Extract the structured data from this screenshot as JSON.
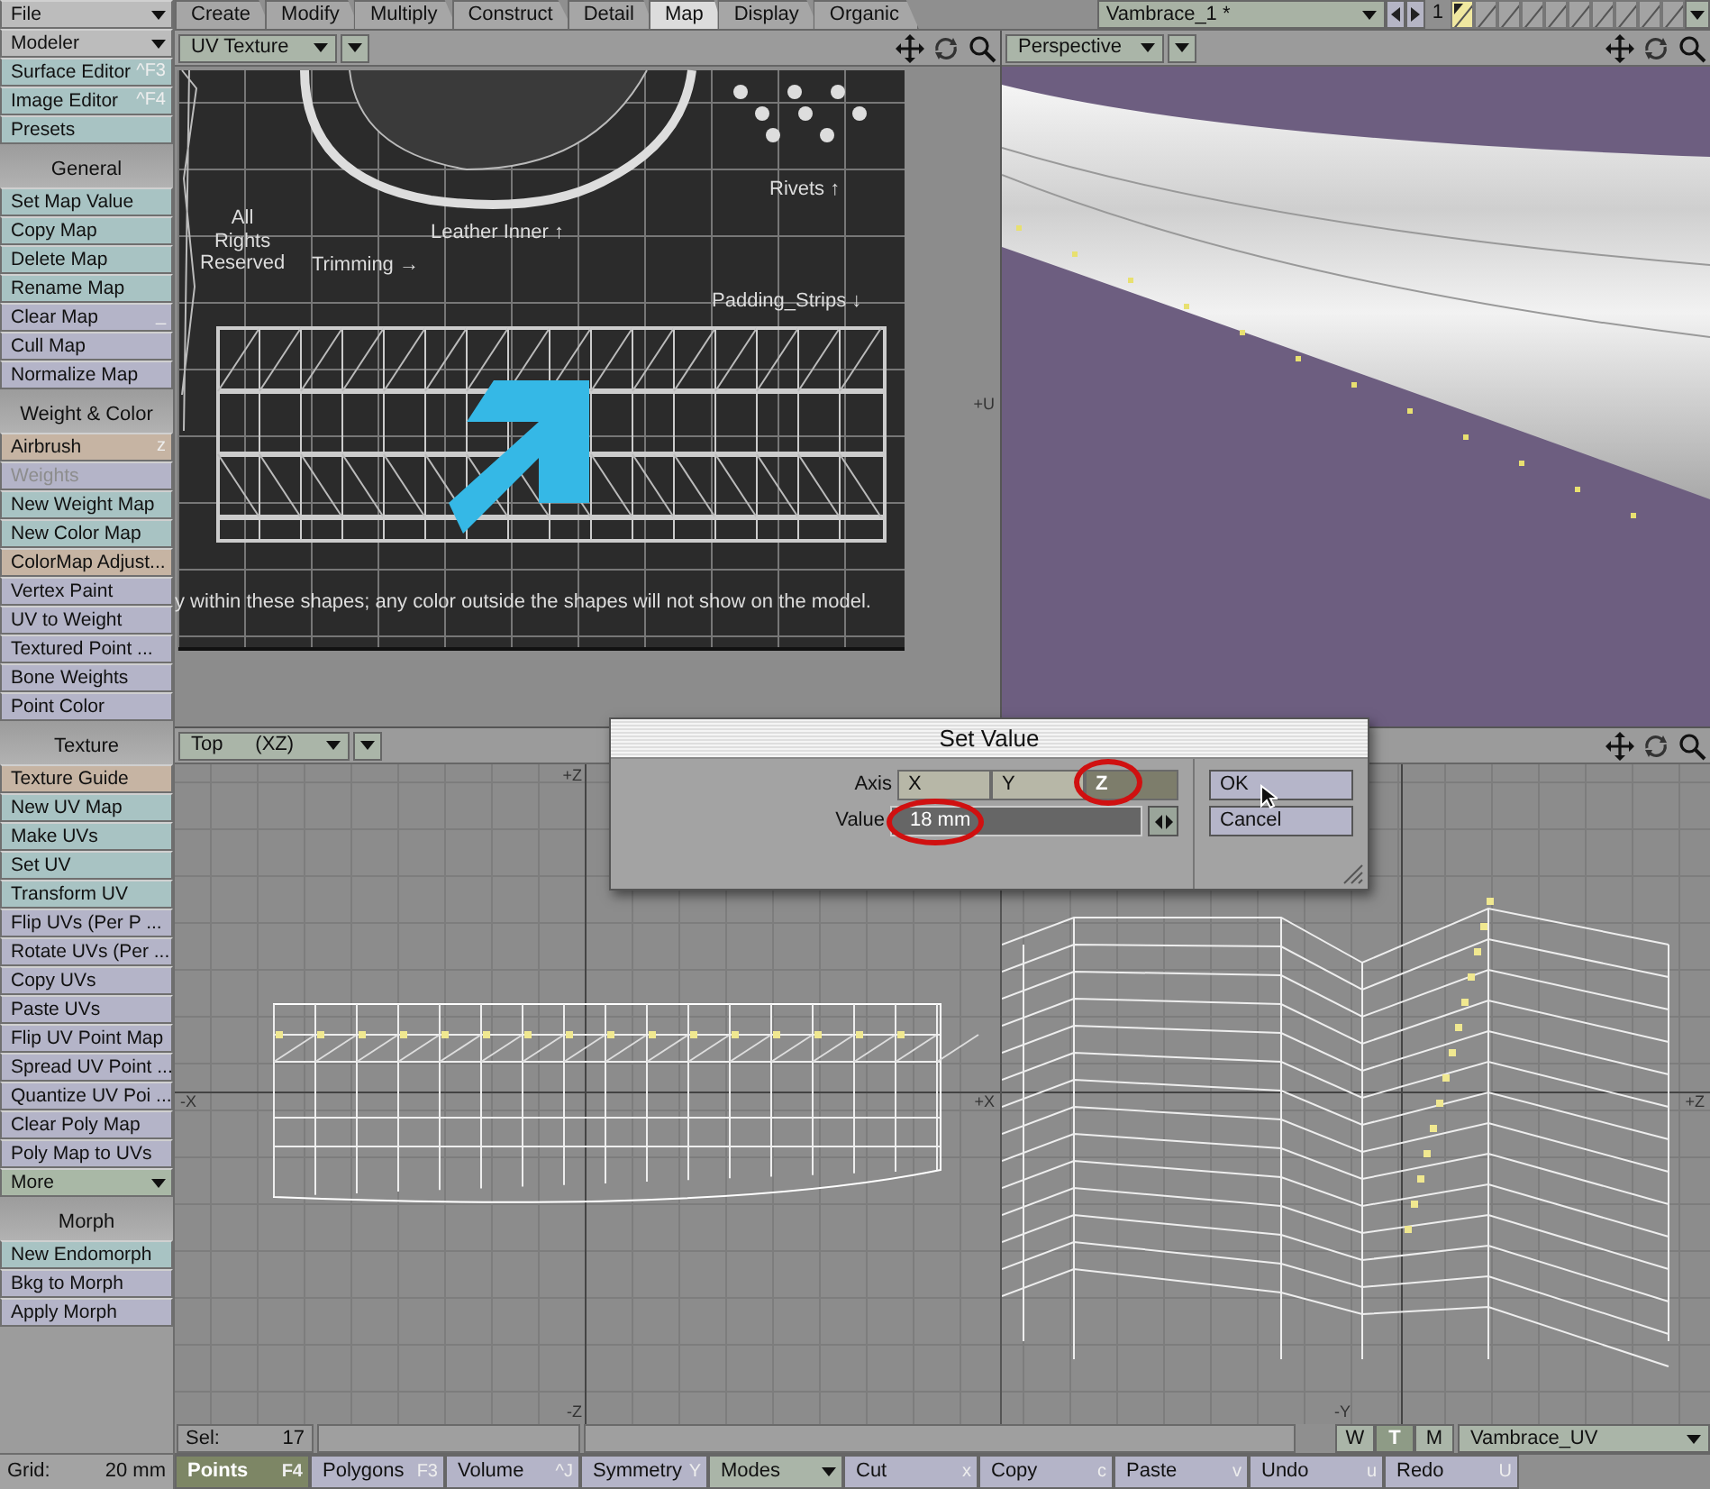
{
  "sidebar": {
    "items": [
      {
        "kind": "dropdown",
        "label": "File"
      },
      {
        "kind": "dropdown",
        "label": "Modeler"
      },
      {
        "kind": "button",
        "label": "Surface Editor",
        "shortcut": "^F3",
        "color": "#a8c3c3"
      },
      {
        "kind": "button",
        "label": "Image Editor",
        "shortcut": "^F4",
        "color": "#a8c3c3"
      },
      {
        "kind": "button",
        "label": "Presets",
        "color": "#a8c3c3"
      },
      {
        "kind": "header",
        "label": "General"
      },
      {
        "kind": "button",
        "label": "Set Map Value",
        "color": "#a8c3c3"
      },
      {
        "kind": "button",
        "label": "Copy Map",
        "color": "#a8c3c3"
      },
      {
        "kind": "button",
        "label": "Delete Map",
        "color": "#a8c3c3"
      },
      {
        "kind": "button",
        "label": "Rename Map",
        "color": "#a8c3c3"
      },
      {
        "kind": "button",
        "label": "Clear Map",
        "shortcut": "_",
        "color": "#b4b4c8"
      },
      {
        "kind": "button",
        "label": "Cull Map",
        "color": "#b4b4c8"
      },
      {
        "kind": "button",
        "label": "Normalize Map",
        "color": "#b4b4c8"
      },
      {
        "kind": "header",
        "label": "Weight & Color"
      },
      {
        "kind": "button",
        "label": "Airbrush",
        "shortcut": "z",
        "color": "#c6b4a3"
      },
      {
        "kind": "button",
        "label": "Weights",
        "disabled": true,
        "color": "#b4b4c8"
      },
      {
        "kind": "button",
        "label": "New Weight Map",
        "color": "#a8c3c3"
      },
      {
        "kind": "button",
        "label": "New Color Map",
        "color": "#a8c3c3"
      },
      {
        "kind": "button",
        "label": "ColorMap Adjust...",
        "color": "#c6b4a3"
      },
      {
        "kind": "button",
        "label": "Vertex Paint",
        "color": "#b4b4c8"
      },
      {
        "kind": "button",
        "label": "UV to Weight",
        "color": "#b4b4c8"
      },
      {
        "kind": "button",
        "label": "Textured Point ...",
        "color": "#b4b4c8"
      },
      {
        "kind": "button",
        "label": "Bone Weights",
        "color": "#b4b4c8"
      },
      {
        "kind": "button",
        "label": "Point Color",
        "color": "#b4b4c8"
      },
      {
        "kind": "header",
        "label": "Texture"
      },
      {
        "kind": "button",
        "label": "Texture Guide",
        "color": "#c6b4a3"
      },
      {
        "kind": "button",
        "label": "New UV Map",
        "color": "#a8c3c3"
      },
      {
        "kind": "button",
        "label": "Make UVs",
        "color": "#a8c3c3"
      },
      {
        "kind": "button",
        "label": "Set UV",
        "color": "#a8c3c3"
      },
      {
        "kind": "button",
        "label": "Transform UV",
        "color": "#a8c3c3"
      },
      {
        "kind": "button",
        "label": "Flip UVs (Per P ...",
        "color": "#b4b4c8"
      },
      {
        "kind": "button",
        "label": "Rotate UVs (Per ...",
        "color": "#b4b4c8"
      },
      {
        "kind": "button",
        "label": "Copy UVs",
        "color": "#b4b4c8"
      },
      {
        "kind": "button",
        "label": "Paste UVs",
        "color": "#b4b4c8"
      },
      {
        "kind": "button",
        "label": "Flip UV Point Map",
        "color": "#b4b4c8"
      },
      {
        "kind": "button",
        "label": "Spread UV Point ...",
        "color": "#b4b4c8"
      },
      {
        "kind": "button",
        "label": "Quantize UV Poi ...",
        "color": "#b4b4c8"
      },
      {
        "kind": "button",
        "label": "Clear Poly Map",
        "color": "#b4b4c8"
      },
      {
        "kind": "button",
        "label": "Poly Map to UVs",
        "color": "#b4b4c8"
      },
      {
        "kind": "dropdown",
        "label": "More",
        "color": "#a9b8a6"
      },
      {
        "kind": "header",
        "label": "Morph"
      },
      {
        "kind": "button",
        "label": "New Endomorph",
        "color": "#a8c3c3"
      },
      {
        "kind": "button",
        "label": "Bkg to Morph",
        "color": "#b4b4c8"
      },
      {
        "kind": "button",
        "label": "Apply Morph",
        "color": "#b4b4c8"
      }
    ],
    "grid": {
      "label": "Grid:",
      "value": "20 mm"
    }
  },
  "tabs": [
    {
      "label": "Create",
      "selected": false
    },
    {
      "label": "Modify",
      "selected": false
    },
    {
      "label": "Multiply",
      "selected": false
    },
    {
      "label": "Construct",
      "selected": false
    },
    {
      "label": "Detail",
      "selected": false
    },
    {
      "label": "Map",
      "selected": true
    },
    {
      "label": "Display",
      "selected": false
    },
    {
      "label": "Organic",
      "selected": false
    }
  ],
  "object_selector": {
    "value": "Vambrace_1 *"
  },
  "layer_bar": {
    "number": "1",
    "layers": [
      {
        "selected": true
      },
      {
        "selected": false
      },
      {
        "selected": false
      },
      {
        "selected": false
      },
      {
        "selected": false
      },
      {
        "selected": false
      },
      {
        "selected": false
      },
      {
        "selected": false
      },
      {
        "selected": false
      },
      {
        "selected": false
      }
    ]
  },
  "viewports": [
    {
      "kind": "uv",
      "view": "UV Texture",
      "axis_labels": {
        "right": "+U"
      },
      "texture_labels": [
        "All\nRights\nReserved",
        "Leather Inner ↑",
        "Trimming →",
        "Rivets ↑",
        "Padding_Strips ↓",
        "y within these shapes; any color outside the shapes will not show on the model."
      ]
    },
    {
      "kind": "perspective",
      "view": "Perspective"
    },
    {
      "kind": "top",
      "view": "Top",
      "plane": "(XZ)",
      "axis_labels": {
        "top": "+Z",
        "bottom": "-Z",
        "left": "-X",
        "right": "+X"
      }
    },
    {
      "kind": "side",
      "axis_labels": {
        "right": "+Z",
        "bottom": "-Y"
      }
    }
  ],
  "dialog": {
    "title": "Set Value",
    "axis": {
      "label": "Axis",
      "options": [
        {
          "label": "X",
          "selected": false
        },
        {
          "label": "Y",
          "selected": false
        },
        {
          "label": "Z",
          "selected": true
        }
      ]
    },
    "value": {
      "label": "Value",
      "value": "18 mm"
    },
    "buttons": [
      "OK",
      "Cancel"
    ]
  },
  "status": {
    "sel_label": "Sel:",
    "sel_count": "17",
    "modes": [
      {
        "label": "W",
        "selected": false
      },
      {
        "label": "T",
        "selected": true
      },
      {
        "label": "M",
        "selected": false
      }
    ],
    "map": "Vambrace_UV"
  },
  "toolbar": [
    {
      "kind": "button",
      "label": "Points",
      "shortcut": "F4",
      "selected": true
    },
    {
      "kind": "button",
      "label": "Polygons",
      "shortcut": "F3",
      "selected": false
    },
    {
      "kind": "button",
      "label": "Volume",
      "shortcut": "^J",
      "selected": false
    },
    {
      "kind": "button",
      "label": "Symmetry",
      "shortcut": "Y",
      "selected": false
    },
    {
      "kind": "dropdown",
      "label": "Modes"
    },
    {
      "kind": "button",
      "label": "Cut",
      "shortcut": "x",
      "selected": false
    },
    {
      "kind": "button",
      "label": "Copy",
      "shortcut": "c",
      "selected": false
    },
    {
      "kind": "button",
      "label": "Paste",
      "shortcut": "v",
      "selected": false
    },
    {
      "kind": "button",
      "label": "Undo",
      "shortcut": "u",
      "selected": false
    },
    {
      "kind": "button",
      "label": "Redo",
      "shortcut": "U",
      "selected": false
    }
  ]
}
